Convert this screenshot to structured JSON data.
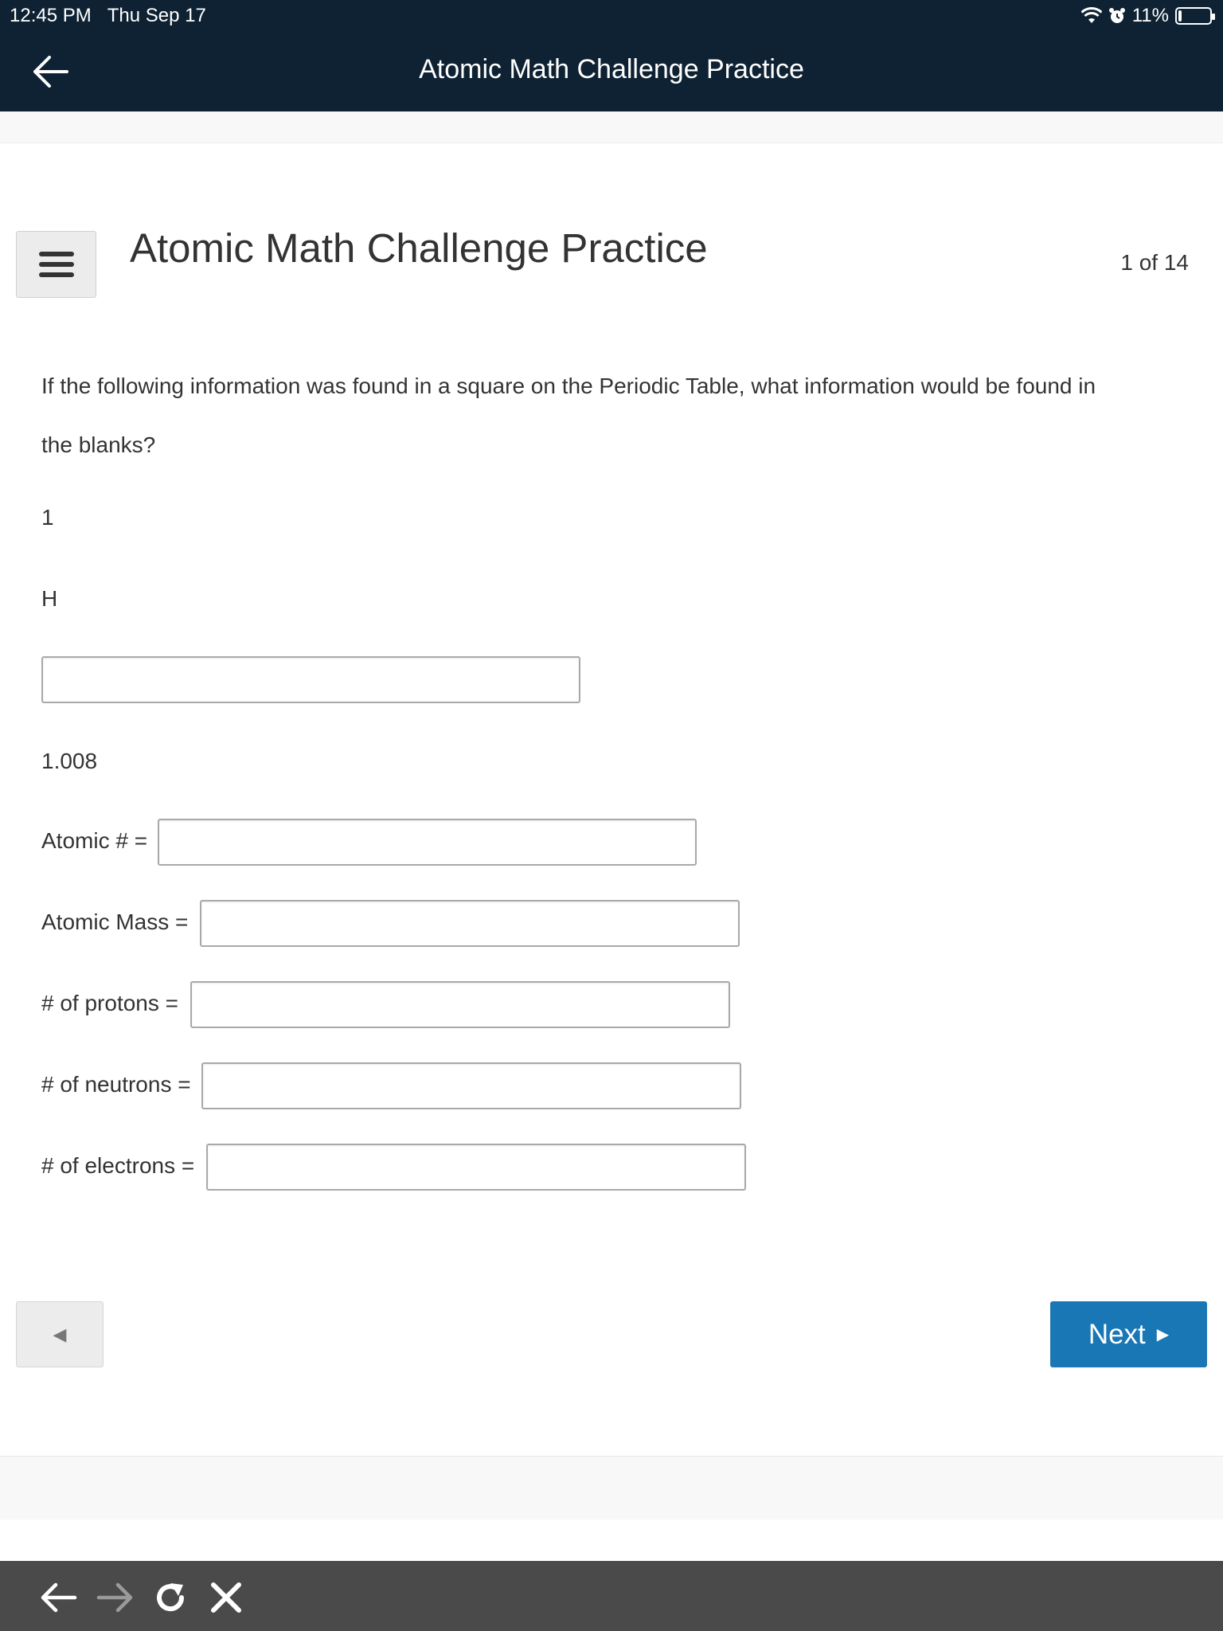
{
  "status_bar": {
    "time": "12:45 PM",
    "date": "Thu Sep 17",
    "battery_percent_label": "11%",
    "battery_level": 0.11
  },
  "nav": {
    "title": "Atomic Math Challenge Practice",
    "back_icon": "back-arrow-icon"
  },
  "header": {
    "menu_icon": "hamburger-menu-icon",
    "title": "Atomic Math Challenge Practice",
    "counter": "1 of 14"
  },
  "question": {
    "text": "If the following information was found in a square on the Periodic Table, what information would be found in the blanks?",
    "element_number": "1",
    "element_symbol": "H",
    "element_name_value": "",
    "element_mass": "1.008"
  },
  "fields": [
    {
      "label": "Atomic # =",
      "value": ""
    },
    {
      "label": "Atomic Mass =",
      "value": ""
    },
    {
      "label": "# of protons =",
      "value": ""
    },
    {
      "label": "# of neutrons =",
      "value": ""
    },
    {
      "label": "# of electrons =",
      "value": ""
    }
  ],
  "navigation": {
    "prev_symbol": "◀",
    "next_label": "Next",
    "next_symbol": "▶"
  },
  "toolbar": {
    "icons": [
      "back-arrow-icon",
      "forward-arrow-icon",
      "reload-icon",
      "close-icon"
    ]
  },
  "colors": {
    "top_bar": "#0e2234",
    "next_button": "#1a77b5",
    "toolbar": "#4a4a4a"
  }
}
